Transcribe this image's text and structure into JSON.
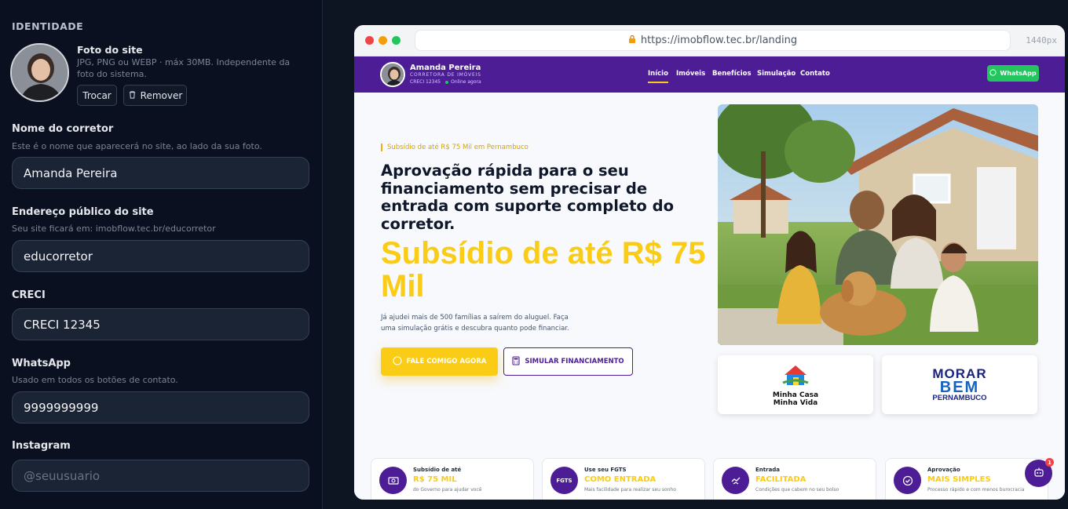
{
  "panel": {
    "section_title": "IDENTIDADE",
    "photo": {
      "title": "Foto do site",
      "hint": "JPG, PNG ou WEBP · máx 30MB. Independente da foto do sistema.",
      "change_label": "Trocar",
      "remove_label": "Remover"
    },
    "fields": {
      "name": {
        "label": "Nome do corretor",
        "hint": "Este é o nome que aparecerá no site, ao lado da sua foto.",
        "value": "Amanda Pereira"
      },
      "address": {
        "label": "Endereço público do site",
        "hint": "Seu site ficará em: imobflow.tec.br/educorretor",
        "value": "educorretor"
      },
      "creci": {
        "label": "CRECI",
        "value": "CRECI 12345"
      },
      "whatsapp": {
        "label": "WhatsApp",
        "hint": "Usado em todos os botões de contato.",
        "value": "9999999999"
      },
      "instagram": {
        "label": "Instagram",
        "placeholder": "@seuusuario",
        "value": ""
      }
    }
  },
  "browser": {
    "url": "https://imobflow.tec.br/landing",
    "viewport_label": "1440px"
  },
  "site": {
    "header": {
      "name": "Amanda Pereira",
      "subtitle": "CORRETORA DE IMÓVEIS",
      "creci": "CRECI 12345",
      "status": "Online agora",
      "nav": [
        "Início",
        "Imóveis",
        "Benefícios",
        "Simulação",
        "Contato"
      ],
      "active_nav": "Início",
      "whatsapp_label": "WhatsApp"
    },
    "hero": {
      "eyebrow": "Subsídio de até R$ 75 Mil em Pernambuco",
      "title": "Aprovação rápida para o seu financiamento sem precisar de entrada com suporte completo do corretor.",
      "highlight": "Subsídio de até R$ 75 Mil",
      "description": "Já ajudei mais de 500 famílias a saírem do aluguel. Faça uma simulação grátis e descubra quanto pode financiar.",
      "cta_primary": "FALE COMIGO AGORA",
      "cta_secondary": "SIMULAR FINANCIAMENTO"
    },
    "logos": {
      "mcmv_line1": "Minha Casa",
      "mcmv_line2": "Minha Vida",
      "morar_line1": "MORAR",
      "morar_line2": "BEM",
      "morar_line3": "PERNAMBUCO"
    },
    "stats": [
      {
        "icon": "money-icon",
        "line1": "Subsídio de até",
        "line2": "R$ 75 MIL",
        "line3": "do Governo para ajudar você"
      },
      {
        "icon": "fgts-icon",
        "icon_text": "FGTS",
        "line1": "Use seu FGTS",
        "line2": "COMO ENTRADA",
        "line3": "Mais facilidade para realizar seu sonho"
      },
      {
        "icon": "handshake-icon",
        "line1": "Entrada",
        "line2": "FACILITADA",
        "line3": "Condições que cabem no seu bolso"
      },
      {
        "icon": "check-circle-icon",
        "line1": "Aprovação",
        "line2": "MAIS SIMPLES",
        "line3": "Processo rápido e com menos burocracia"
      }
    ],
    "chat_badge": "1"
  },
  "colors": {
    "panel_bg": "#0a1020",
    "brand_purple": "#4c1d95",
    "accent_yellow": "#facc15",
    "whatsapp_green": "#22c55e"
  }
}
